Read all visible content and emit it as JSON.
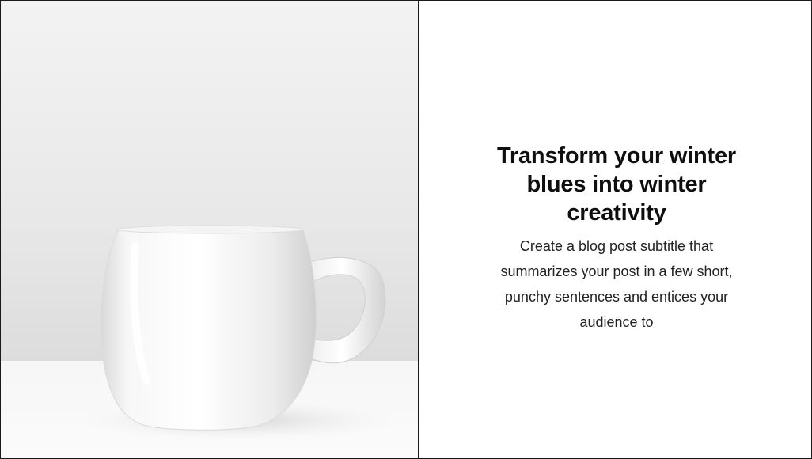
{
  "post": {
    "title": "Transform your winter blues into winter creativity",
    "subtitle": "Create a blog post subtitle that summarizes your post in a few short, punchy sentences and entices your audience to"
  },
  "image": {
    "subject": "white-mug-photo"
  },
  "colors": {
    "border": "#1a1a1a",
    "title": "#0f0f0f",
    "subtitle": "#222222",
    "background": "#ffffff"
  }
}
